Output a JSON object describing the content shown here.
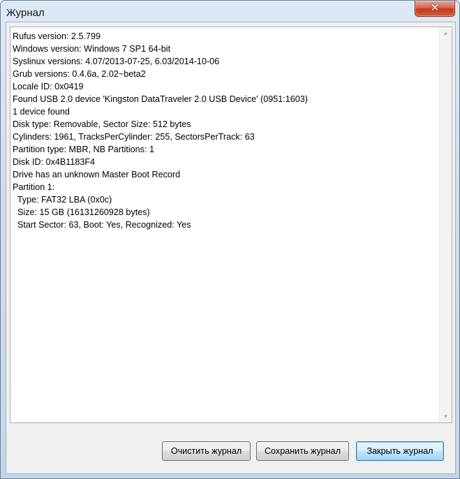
{
  "window": {
    "title": "Журнал",
    "close_glyph": "✕"
  },
  "log": {
    "lines": [
      "Rufus version: 2.5.799",
      "Windows version: Windows 7 SP1 64-bit",
      "Syslinux versions: 4.07/2013-07-25, 6.03/2014-10-06",
      "Grub versions: 0.4.6a, 2.02~beta2",
      "Locale ID: 0x0419",
      "Found USB 2.0 device 'Kingston DataTraveler 2.0 USB Device' (0951:1603)",
      "1 device found",
      "Disk type: Removable, Sector Size: 512 bytes",
      "Cylinders: 1961, TracksPerCylinder: 255, SectorsPerTrack: 63",
      "Partition type: MBR, NB Partitions: 1",
      "Disk ID: 0x4B1183F4",
      "Drive has an unknown Master Boot Record",
      "Partition 1:",
      "  Type: FAT32 LBA (0x0c)",
      "  Size: 15 GB (16131260928 bytes)",
      "  Start Sector: 63, Boot: Yes, Recognized: Yes"
    ]
  },
  "scrollbar": {
    "up_icon": "scroll-up-arrow",
    "down_icon": "scroll-down-arrow"
  },
  "buttons": {
    "clear_label": "Очистить журнал",
    "save_label": "Сохранить журнал",
    "close_label": "Закрыть журнал"
  }
}
